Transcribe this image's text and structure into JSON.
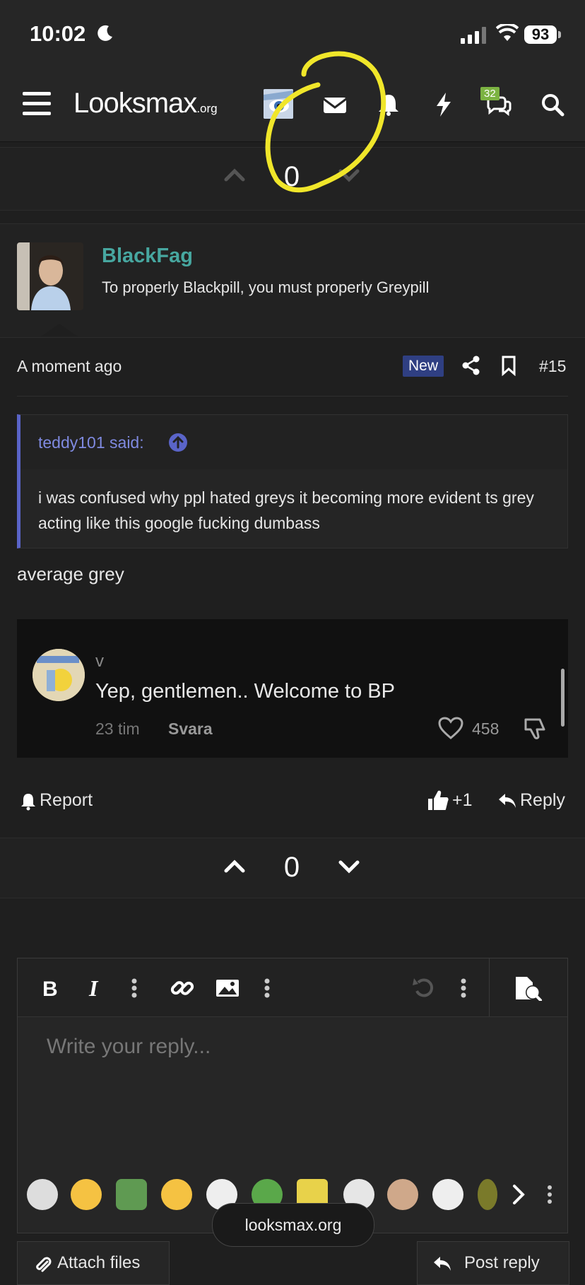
{
  "status_bar": {
    "time": "10:02",
    "battery": "93"
  },
  "nav": {
    "logo_main": "Looksmax",
    "logo_suffix": ".org",
    "chat_badge": "32"
  },
  "vote_top": {
    "count": "0"
  },
  "post": {
    "username": "BlackFag",
    "user_title": "To properly Blackpill, you must properly Greypill",
    "timestamp": "A moment ago",
    "new_badge": "New",
    "post_number": "#15",
    "quote": {
      "author": "teddy101 said:",
      "text": "i was confused why ppl hated greys it becoming more evident ts grey acting like this google fucking dumbass"
    },
    "body": "average grey",
    "embed": {
      "name": "v",
      "comment": "Yep, gentlemen.. Welcome to BP",
      "time": "23 tim",
      "reply": "Svara",
      "likes": "458"
    },
    "actions": {
      "report": "Report",
      "like_count": "+1",
      "reply": "Reply"
    }
  },
  "vote_bottom": {
    "count": "0"
  },
  "editor": {
    "placeholder": "Write your reply..."
  },
  "footer": {
    "url": "looksmax.org",
    "attach_files": "Attach files",
    "post_reply": "Post reply"
  },
  "colors": {
    "accent_username": "#47a7a0",
    "quote_border": "#5a64c8",
    "new_badge": "#2f3f82",
    "annotation": "#f0e62a"
  }
}
